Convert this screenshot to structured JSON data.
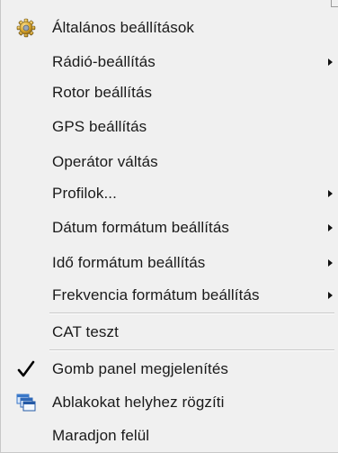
{
  "menu": {
    "items": [
      {
        "label": "Általános beállítások",
        "icon": "gear-icon",
        "submenu": false
      },
      {
        "label": "Rádió-beállítás",
        "icon": "",
        "submenu": true
      },
      {
        "label": "Rotor beállítás",
        "icon": "",
        "submenu": false
      },
      {
        "label": "GPS beállítás",
        "icon": "",
        "submenu": false
      },
      {
        "label": "Operátor váltás",
        "icon": "",
        "submenu": false
      },
      {
        "label": "Profilok...",
        "icon": "",
        "submenu": true
      },
      {
        "label": "Dátum formátum beállítás",
        "icon": "",
        "submenu": true
      },
      {
        "label": "Idő formátum beállítás",
        "icon": "",
        "submenu": true
      },
      {
        "label": "Frekvencia formátum beállítás",
        "icon": "",
        "submenu": true
      },
      {
        "label": "CAT teszt",
        "icon": "",
        "submenu": false
      },
      {
        "label": "Gomb panel megjelenítés",
        "icon": "checkmark-icon",
        "checked": true,
        "submenu": false
      },
      {
        "label": "Ablakokat helyhez rögzíti",
        "icon": "windows-stack-icon",
        "submenu": false
      },
      {
        "label": "Maradjon felül",
        "icon": "",
        "submenu": false
      }
    ]
  }
}
